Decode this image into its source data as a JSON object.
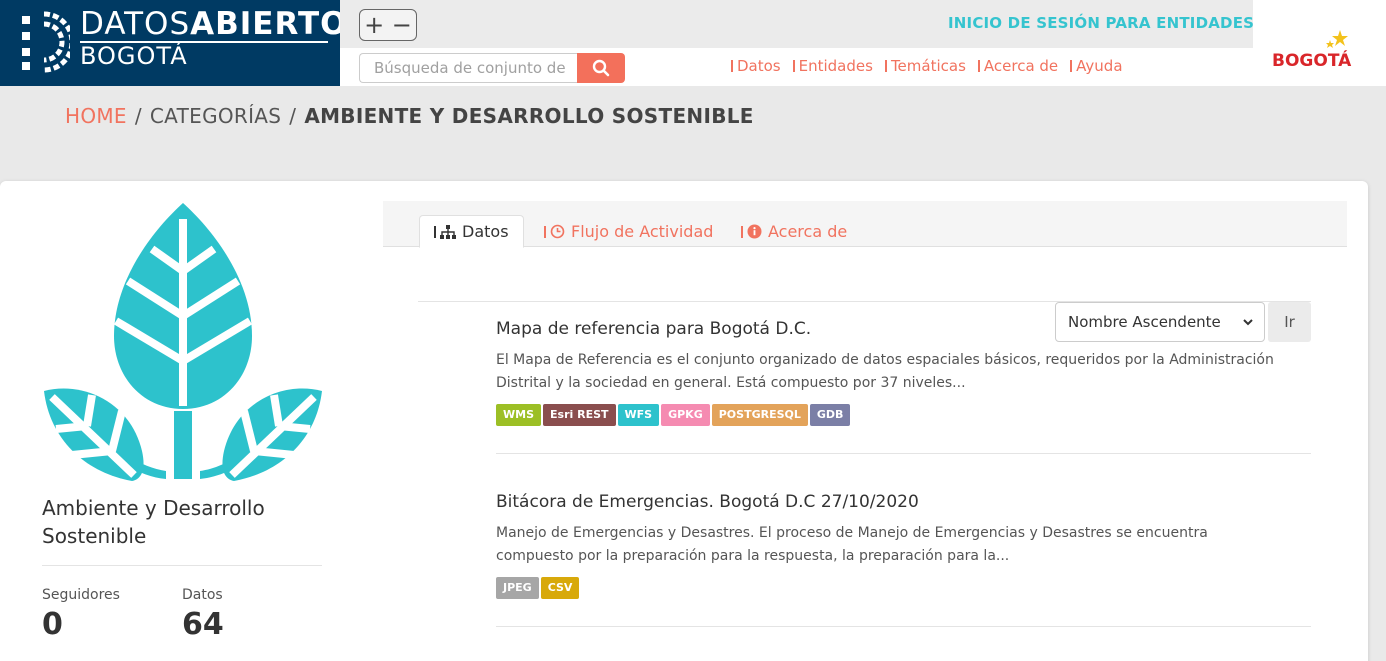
{
  "header": {
    "logo_word1": "DATOS",
    "logo_word2": "ABIERTOS",
    "logo_city": "BOGOTÁ",
    "zoom_controls": "+ −",
    "session_link": "INICIO DE SESIÓN PARA ENTIDADES",
    "search_placeholder": "Búsqueda de conjunto de",
    "nav": [
      "Datos",
      "Entidades",
      "Temáticas",
      "Acerca de",
      "Ayuda"
    ],
    "city_logo_text": "BOGOTÁ",
    "accent_color": "#f1735f",
    "brand_color": "#003a63",
    "teal_color": "#35c4cf"
  },
  "breadcrumb": {
    "home": "HOME",
    "separator": "/",
    "categories": "CATEGORÍAS",
    "current": "AMBIENTE Y DESARROLLO SOSTENIBLE"
  },
  "sidebar": {
    "image_icon": "leaf-icon",
    "category_title": "Ambiente y Desarrollo Sostenible",
    "followers_label": "Seguidores",
    "followers_value": "0",
    "datasets_label": "Datos",
    "datasets_value": "64"
  },
  "tabs": [
    {
      "label": "Datos",
      "icon": "sitemap-icon",
      "active": true
    },
    {
      "label": "Flujo de Actividad",
      "icon": "clock-icon",
      "active": false
    },
    {
      "label": "Acerca de",
      "icon": "info-icon",
      "active": false
    }
  ],
  "sort": {
    "selected": "Nombre Ascendente",
    "go_label": "Ir"
  },
  "datasets": [
    {
      "title": "Mapa de referencia para Bogotá D.C.",
      "description": "El Mapa de Referencia es el conjunto organizado de datos espaciales básicos, requeridos por la Administración Distrital y la sociedad en general. Está compuesto por 37 niveles...",
      "formats": [
        {
          "label": "WMS",
          "color": "#9cbf25"
        },
        {
          "label": "Esri REST",
          "color": "#8a4e4e"
        },
        {
          "label": "WFS",
          "color": "#2dc2cc"
        },
        {
          "label": "GPKG",
          "color": "#f58bb1"
        },
        {
          "label": "POSTGRESQL",
          "color": "#e3a35a"
        },
        {
          "label": "GDB",
          "color": "#7b7fa6"
        }
      ]
    },
    {
      "title": "Bitácora de Emergencias. Bogotá D.C 27/10/2020",
      "description": "Manejo de Emergencias y Desastres. El proceso de Manejo de Emergencias y Desastres se encuentra compuesto por la preparación para la respuesta, la preparación para la...",
      "formats": [
        {
          "label": "JPEG",
          "color": "#a6a6a6"
        },
        {
          "label": "CSV",
          "color": "#d8a90a"
        }
      ]
    }
  ]
}
